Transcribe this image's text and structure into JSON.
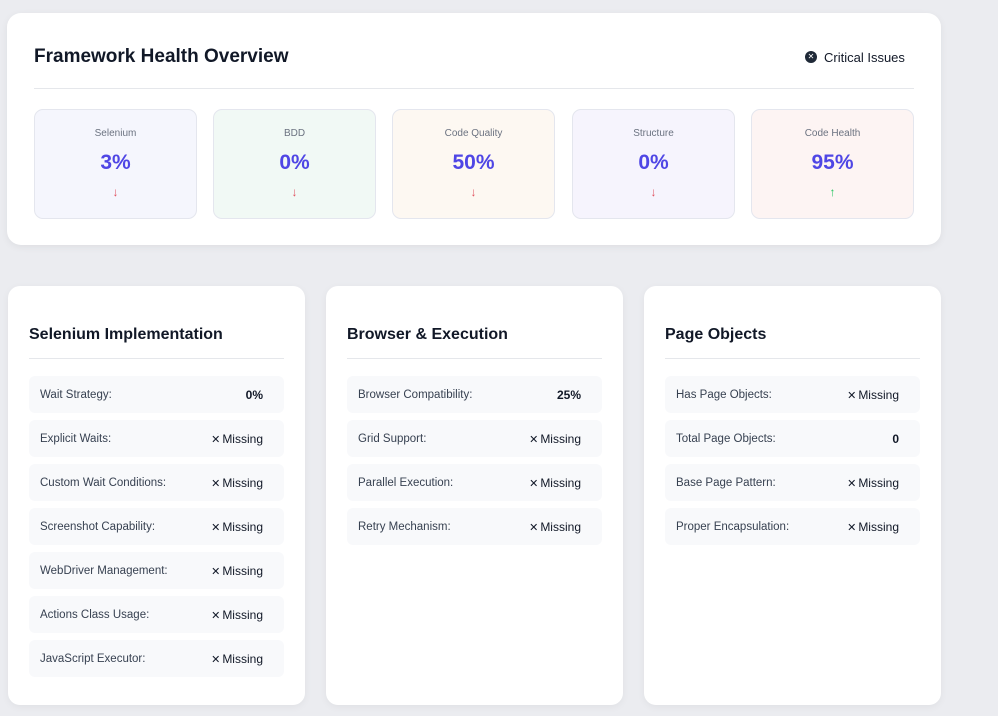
{
  "overview": {
    "title": "Framework Health Overview",
    "critical_label": "Critical Issues",
    "metrics": [
      {
        "label": "Selenium",
        "value": "3%",
        "trend": "down",
        "arrow": "↓",
        "bg": "#f5f6fd"
      },
      {
        "label": "BDD",
        "value": "0%",
        "trend": "down",
        "arrow": "↓",
        "bg": "#f1f9f5"
      },
      {
        "label": "Code Quality",
        "value": "50%",
        "trend": "down",
        "arrow": "↓",
        "bg": "#fdf8f2"
      },
      {
        "label": "Structure",
        "value": "0%",
        "trend": "down",
        "arrow": "↓",
        "bg": "#f6f4fd"
      },
      {
        "label": "Code Health",
        "value": "95%",
        "trend": "up",
        "arrow": "↑",
        "bg": "#fdf4f3"
      }
    ]
  },
  "panels": [
    {
      "title": "Selenium Implementation",
      "rows": [
        {
          "label": "Wait Strategy:",
          "value": "0%",
          "missing": false
        },
        {
          "label": "Explicit Waits:",
          "value": "Missing",
          "missing": true
        },
        {
          "label": "Custom Wait Conditions:",
          "value": "Missing",
          "missing": true
        },
        {
          "label": "Screenshot Capability:",
          "value": "Missing",
          "missing": true
        },
        {
          "label": "WebDriver Management:",
          "value": "Missing",
          "missing": true
        },
        {
          "label": "Actions Class Usage:",
          "value": "Missing",
          "missing": true
        },
        {
          "label": "JavaScript Executor:",
          "value": "Missing",
          "missing": true
        }
      ]
    },
    {
      "title": "Browser & Execution",
      "rows": [
        {
          "label": "Browser Compatibility:",
          "value": "25%",
          "missing": false
        },
        {
          "label": "Grid Support:",
          "value": "Missing",
          "missing": true
        },
        {
          "label": "Parallel Execution:",
          "value": "Missing",
          "missing": true
        },
        {
          "label": "Retry Mechanism:",
          "value": "Missing",
          "missing": true
        }
      ]
    },
    {
      "title": "Page Objects",
      "rows": [
        {
          "label": "Has Page Objects:",
          "value": "Missing",
          "missing": true
        },
        {
          "label": "Total Page Objects:",
          "value": "0",
          "missing": false
        },
        {
          "label": "Base Page Pattern:",
          "value": "Missing",
          "missing": true
        },
        {
          "label": "Proper Encapsulation:",
          "value": "Missing",
          "missing": true
        }
      ]
    }
  ]
}
